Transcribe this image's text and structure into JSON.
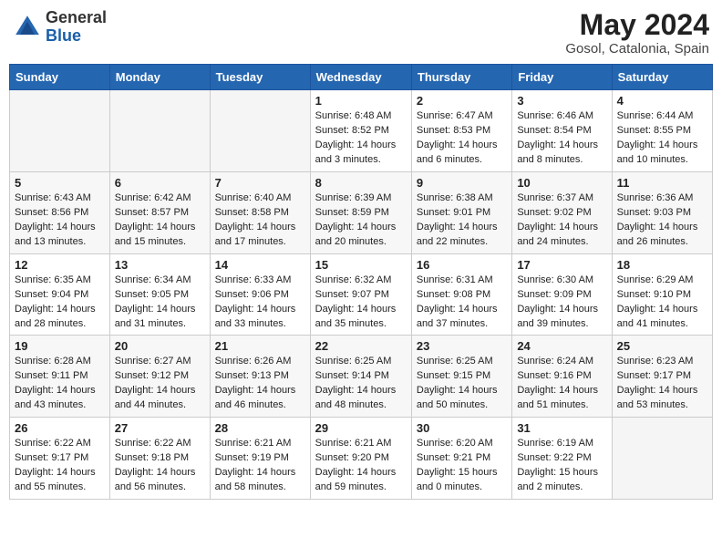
{
  "header": {
    "logo_general": "General",
    "logo_blue": "Blue",
    "month_year": "May 2024",
    "location": "Gosol, Catalonia, Spain"
  },
  "weekdays": [
    "Sunday",
    "Monday",
    "Tuesday",
    "Wednesday",
    "Thursday",
    "Friday",
    "Saturday"
  ],
  "weeks": [
    [
      {
        "day": "",
        "sunrise": "",
        "sunset": "",
        "daylight": ""
      },
      {
        "day": "",
        "sunrise": "",
        "sunset": "",
        "daylight": ""
      },
      {
        "day": "",
        "sunrise": "",
        "sunset": "",
        "daylight": ""
      },
      {
        "day": "1",
        "sunrise": "Sunrise: 6:48 AM",
        "sunset": "Sunset: 8:52 PM",
        "daylight": "Daylight: 14 hours and 3 minutes."
      },
      {
        "day": "2",
        "sunrise": "Sunrise: 6:47 AM",
        "sunset": "Sunset: 8:53 PM",
        "daylight": "Daylight: 14 hours and 6 minutes."
      },
      {
        "day": "3",
        "sunrise": "Sunrise: 6:46 AM",
        "sunset": "Sunset: 8:54 PM",
        "daylight": "Daylight: 14 hours and 8 minutes."
      },
      {
        "day": "4",
        "sunrise": "Sunrise: 6:44 AM",
        "sunset": "Sunset: 8:55 PM",
        "daylight": "Daylight: 14 hours and 10 minutes."
      }
    ],
    [
      {
        "day": "5",
        "sunrise": "Sunrise: 6:43 AM",
        "sunset": "Sunset: 8:56 PM",
        "daylight": "Daylight: 14 hours and 13 minutes."
      },
      {
        "day": "6",
        "sunrise": "Sunrise: 6:42 AM",
        "sunset": "Sunset: 8:57 PM",
        "daylight": "Daylight: 14 hours and 15 minutes."
      },
      {
        "day": "7",
        "sunrise": "Sunrise: 6:40 AM",
        "sunset": "Sunset: 8:58 PM",
        "daylight": "Daylight: 14 hours and 17 minutes."
      },
      {
        "day": "8",
        "sunrise": "Sunrise: 6:39 AM",
        "sunset": "Sunset: 8:59 PM",
        "daylight": "Daylight: 14 hours and 20 minutes."
      },
      {
        "day": "9",
        "sunrise": "Sunrise: 6:38 AM",
        "sunset": "Sunset: 9:01 PM",
        "daylight": "Daylight: 14 hours and 22 minutes."
      },
      {
        "day": "10",
        "sunrise": "Sunrise: 6:37 AM",
        "sunset": "Sunset: 9:02 PM",
        "daylight": "Daylight: 14 hours and 24 minutes."
      },
      {
        "day": "11",
        "sunrise": "Sunrise: 6:36 AM",
        "sunset": "Sunset: 9:03 PM",
        "daylight": "Daylight: 14 hours and 26 minutes."
      }
    ],
    [
      {
        "day": "12",
        "sunrise": "Sunrise: 6:35 AM",
        "sunset": "Sunset: 9:04 PM",
        "daylight": "Daylight: 14 hours and 28 minutes."
      },
      {
        "day": "13",
        "sunrise": "Sunrise: 6:34 AM",
        "sunset": "Sunset: 9:05 PM",
        "daylight": "Daylight: 14 hours and 31 minutes."
      },
      {
        "day": "14",
        "sunrise": "Sunrise: 6:33 AM",
        "sunset": "Sunset: 9:06 PM",
        "daylight": "Daylight: 14 hours and 33 minutes."
      },
      {
        "day": "15",
        "sunrise": "Sunrise: 6:32 AM",
        "sunset": "Sunset: 9:07 PM",
        "daylight": "Daylight: 14 hours and 35 minutes."
      },
      {
        "day": "16",
        "sunrise": "Sunrise: 6:31 AM",
        "sunset": "Sunset: 9:08 PM",
        "daylight": "Daylight: 14 hours and 37 minutes."
      },
      {
        "day": "17",
        "sunrise": "Sunrise: 6:30 AM",
        "sunset": "Sunset: 9:09 PM",
        "daylight": "Daylight: 14 hours and 39 minutes."
      },
      {
        "day": "18",
        "sunrise": "Sunrise: 6:29 AM",
        "sunset": "Sunset: 9:10 PM",
        "daylight": "Daylight: 14 hours and 41 minutes."
      }
    ],
    [
      {
        "day": "19",
        "sunrise": "Sunrise: 6:28 AM",
        "sunset": "Sunset: 9:11 PM",
        "daylight": "Daylight: 14 hours and 43 minutes."
      },
      {
        "day": "20",
        "sunrise": "Sunrise: 6:27 AM",
        "sunset": "Sunset: 9:12 PM",
        "daylight": "Daylight: 14 hours and 44 minutes."
      },
      {
        "day": "21",
        "sunrise": "Sunrise: 6:26 AM",
        "sunset": "Sunset: 9:13 PM",
        "daylight": "Daylight: 14 hours and 46 minutes."
      },
      {
        "day": "22",
        "sunrise": "Sunrise: 6:25 AM",
        "sunset": "Sunset: 9:14 PM",
        "daylight": "Daylight: 14 hours and 48 minutes."
      },
      {
        "day": "23",
        "sunrise": "Sunrise: 6:25 AM",
        "sunset": "Sunset: 9:15 PM",
        "daylight": "Daylight: 14 hours and 50 minutes."
      },
      {
        "day": "24",
        "sunrise": "Sunrise: 6:24 AM",
        "sunset": "Sunset: 9:16 PM",
        "daylight": "Daylight: 14 hours and 51 minutes."
      },
      {
        "day": "25",
        "sunrise": "Sunrise: 6:23 AM",
        "sunset": "Sunset: 9:17 PM",
        "daylight": "Daylight: 14 hours and 53 minutes."
      }
    ],
    [
      {
        "day": "26",
        "sunrise": "Sunrise: 6:22 AM",
        "sunset": "Sunset: 9:17 PM",
        "daylight": "Daylight: 14 hours and 55 minutes."
      },
      {
        "day": "27",
        "sunrise": "Sunrise: 6:22 AM",
        "sunset": "Sunset: 9:18 PM",
        "daylight": "Daylight: 14 hours and 56 minutes."
      },
      {
        "day": "28",
        "sunrise": "Sunrise: 6:21 AM",
        "sunset": "Sunset: 9:19 PM",
        "daylight": "Daylight: 14 hours and 58 minutes."
      },
      {
        "day": "29",
        "sunrise": "Sunrise: 6:21 AM",
        "sunset": "Sunset: 9:20 PM",
        "daylight": "Daylight: 14 hours and 59 minutes."
      },
      {
        "day": "30",
        "sunrise": "Sunrise: 6:20 AM",
        "sunset": "Sunset: 9:21 PM",
        "daylight": "Daylight: 15 hours and 0 minutes."
      },
      {
        "day": "31",
        "sunrise": "Sunrise: 6:19 AM",
        "sunset": "Sunset: 9:22 PM",
        "daylight": "Daylight: 15 hours and 2 minutes."
      },
      {
        "day": "",
        "sunrise": "",
        "sunset": "",
        "daylight": ""
      }
    ]
  ]
}
